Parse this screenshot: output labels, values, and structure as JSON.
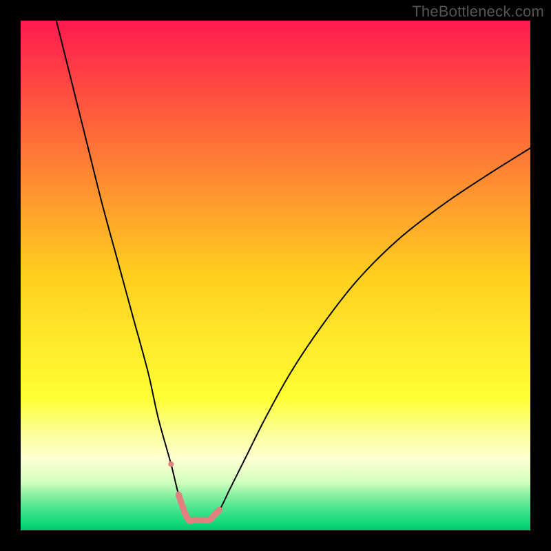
{
  "watermark": "TheBottleneck.com",
  "chart_data": {
    "type": "line",
    "title": "",
    "xlabel": "",
    "ylabel": "",
    "xlim": [
      0,
      100
    ],
    "ylim": [
      0,
      100
    ],
    "grid": false,
    "legend": "none",
    "background": {
      "style": "vertical-gradient",
      "stops": [
        {
          "pos": 0.0,
          "color": "#ff1a4f"
        },
        {
          "pos": 0.5,
          "color": "#ffcf1f"
        },
        {
          "pos": 0.74,
          "color": "#ffff33"
        },
        {
          "pos": 0.815,
          "color": "#fbffa0"
        },
        {
          "pos": 0.86,
          "color": "#fdffd0"
        },
        {
          "pos": 0.905,
          "color": "#d3ffc0"
        },
        {
          "pos": 0.93,
          "color": "#8bf0a0"
        },
        {
          "pos": 0.955,
          "color": "#4fe58f"
        },
        {
          "pos": 0.985,
          "color": "#12d97a"
        },
        {
          "pos": 1.0,
          "color": "#00c86a"
        }
      ]
    },
    "series": [
      {
        "name": "bottleneck-curve",
        "color": "#000000",
        "width": 2,
        "x": [
          7,
          10,
          13,
          16,
          19,
          22,
          25,
          27,
          29.5,
          31,
          32.5,
          34.5,
          37,
          39,
          41,
          44,
          48,
          53,
          59,
          66,
          74,
          83,
          92,
          100
        ],
        "y": [
          100,
          88,
          76,
          64,
          53,
          42,
          31,
          22,
          13,
          7,
          3,
          2,
          2,
          4,
          8,
          14,
          22,
          31,
          40,
          49,
          57,
          64,
          70,
          75
        ]
      }
    ],
    "highlight": {
      "name": "best-fit-region",
      "color": "#e37f7f",
      "width": 9,
      "cap": "round",
      "dot": {
        "x": 29.5,
        "y": 13,
        "r": 4
      },
      "x": [
        31,
        32,
        33,
        34,
        35,
        36,
        37,
        38,
        39
      ],
      "y": [
        7,
        4,
        2,
        2,
        2,
        2,
        2,
        3,
        4
      ]
    }
  }
}
